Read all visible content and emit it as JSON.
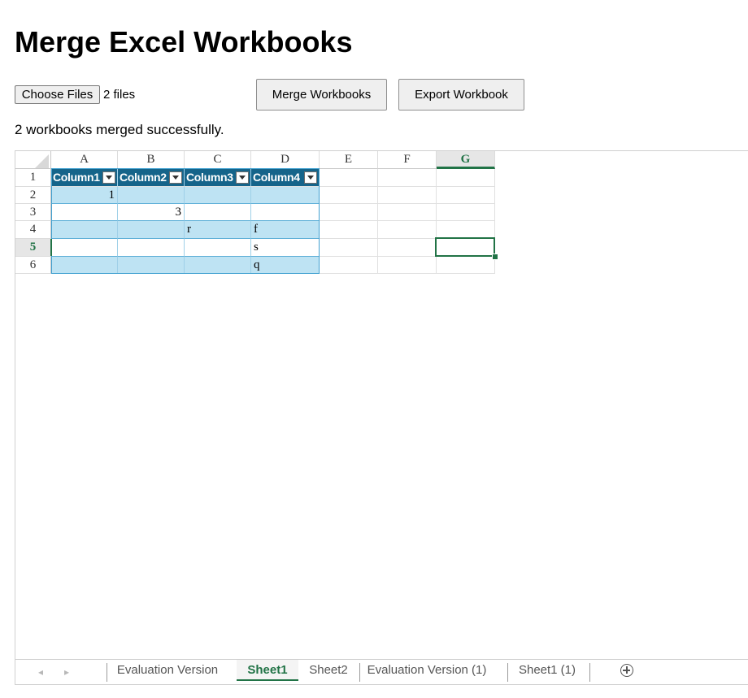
{
  "page": {
    "title": "Merge Excel Workbooks",
    "choose_files_label": "Choose Files",
    "file_status": "2 files",
    "merge_button": "Merge Workbooks",
    "export_button": "Export Workbook",
    "status_message": "2 workbooks merged successfully."
  },
  "spreadsheet": {
    "columns": [
      "A",
      "B",
      "C",
      "D",
      "E",
      "F",
      "G"
    ],
    "rows": [
      "1",
      "2",
      "3",
      "4",
      "5",
      "6"
    ],
    "active_column": "G",
    "active_row": "5",
    "selected_cell": "G5",
    "table": {
      "headers": [
        "Column1",
        "Column2",
        "Column3",
        "Column4"
      ],
      "body": [
        [
          "1",
          "",
          "",
          ""
        ],
        [
          "",
          "3",
          "",
          ""
        ],
        [
          "",
          "",
          "r",
          "f"
        ],
        [
          "",
          "",
          "",
          "s"
        ],
        [
          "",
          "",
          "",
          "q"
        ]
      ]
    },
    "colors": {
      "table_header": "#15648a",
      "table_band": "#bee3f3",
      "accent": "#217346"
    }
  },
  "sheet_tabs": {
    "tabs": [
      "Evaluation Version",
      "Sheet1",
      "Sheet2",
      "Evaluation Version (1)",
      "Sheet1 (1)"
    ],
    "active": "Sheet1",
    "prev_icon": "◂",
    "next_icon": "▸"
  }
}
